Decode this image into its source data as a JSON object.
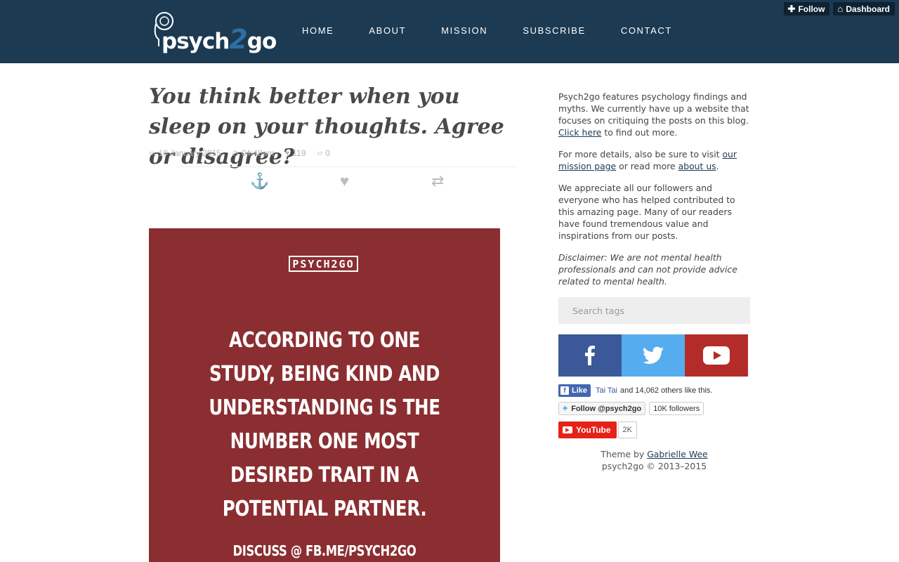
{
  "header": {
    "logo": {
      "part1": "psych",
      "part2": "2",
      "part3": "go"
    },
    "nav": [
      "HOME",
      "ABOUT",
      "MISSION",
      "SUBSCRIBE",
      "CONTACT"
    ],
    "tumblr": {
      "follow_label": "Follow",
      "dashboard_label": "Dashboard"
    },
    "bg_color": "#1c3a52"
  },
  "post": {
    "title": "You think better when you sleep on your thoughts. Agree or disagree?",
    "date": "10 January 2015",
    "time": "04:48am",
    "likes": "119",
    "comments": "0",
    "icons": [
      "calendar-icon",
      "clock-icon",
      "heart-icon",
      "comment-icon"
    ],
    "actions": [
      "anchor-icon",
      "heart-icon",
      "reblog-icon"
    ],
    "image": {
      "badge": "PSYCH2GO",
      "quote": "According to one study, being kind and understanding is the number one most desired trait in a potential partner.",
      "discuss": "DISCUSS @ FB.ME/PSYCH2GO",
      "bg_color": "#8b2e31"
    }
  },
  "sidebar": {
    "p1_text": "Psych2go features psychology findings and myths. We currently have up a website that focuses on critiquing the posts on this blog. ",
    "p1_link": "Click here",
    "p1_after": " to find out more.",
    "p2_text": "For more details, also be sure to visit ",
    "p2_link1": "our mission page",
    "p2_mid": " or read more ",
    "p2_link2": "about us",
    "p2_end": ".",
    "p3": "We appreciate all our followers and everyone who has helped contributed to this amazing page. Many of our readers have found tremendous value and inspirations from our posts.",
    "disclaimer": "Disclaimer: We are not mental health professionals and can not provide advice related to mental health.",
    "search_placeholder": "Search tags",
    "social": [
      {
        "name": "facebook",
        "color": "#3b5998"
      },
      {
        "name": "twitter",
        "color": "#55acee"
      },
      {
        "name": "youtube",
        "color": "#b32c2a"
      }
    ],
    "fb_widget": {
      "like": "Like",
      "name": "Tai Tai",
      "rest": "and 14,062 others like this."
    },
    "tw_widget": {
      "follow": "Follow @psych2go",
      "count": "10K followers"
    },
    "yt_widget": {
      "label": "YouTube",
      "count": "2K"
    }
  },
  "footer": {
    "theme_prefix": "Theme by ",
    "theme_author": "Gabrielle Wee",
    "copyright": "psych2go © 2013–2015"
  }
}
